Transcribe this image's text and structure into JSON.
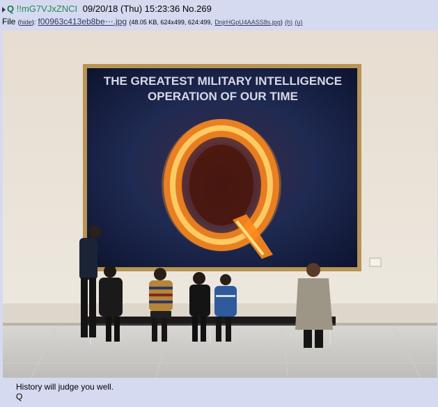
{
  "post": {
    "name": "Q",
    "trip": "!!mG7VJxZNCI",
    "date": "09/20/18 (Thu) 15:23:36",
    "number": "No.269"
  },
  "file": {
    "label": "File",
    "hide_link": "hide",
    "filename": "f00963c413eb8be⋯.jpg",
    "meta": "(48.05 KB, 624x499, 624:499,",
    "original_name": "DnjrHGpU4AASS8s.jpg",
    "h_link": "(h)",
    "u_link": "(u)"
  },
  "image": {
    "banner_line1": "THE GREATEST MILITARY INTELLIGENCE",
    "banner_line2": "OPERATION OF OUR TIME",
    "emblem": "Q"
  },
  "message": {
    "line1": "History will judge you well.",
    "line2": "Q"
  },
  "colors": {
    "background": "#d6daf0",
    "name": "#117743",
    "link": "#34345c"
  }
}
